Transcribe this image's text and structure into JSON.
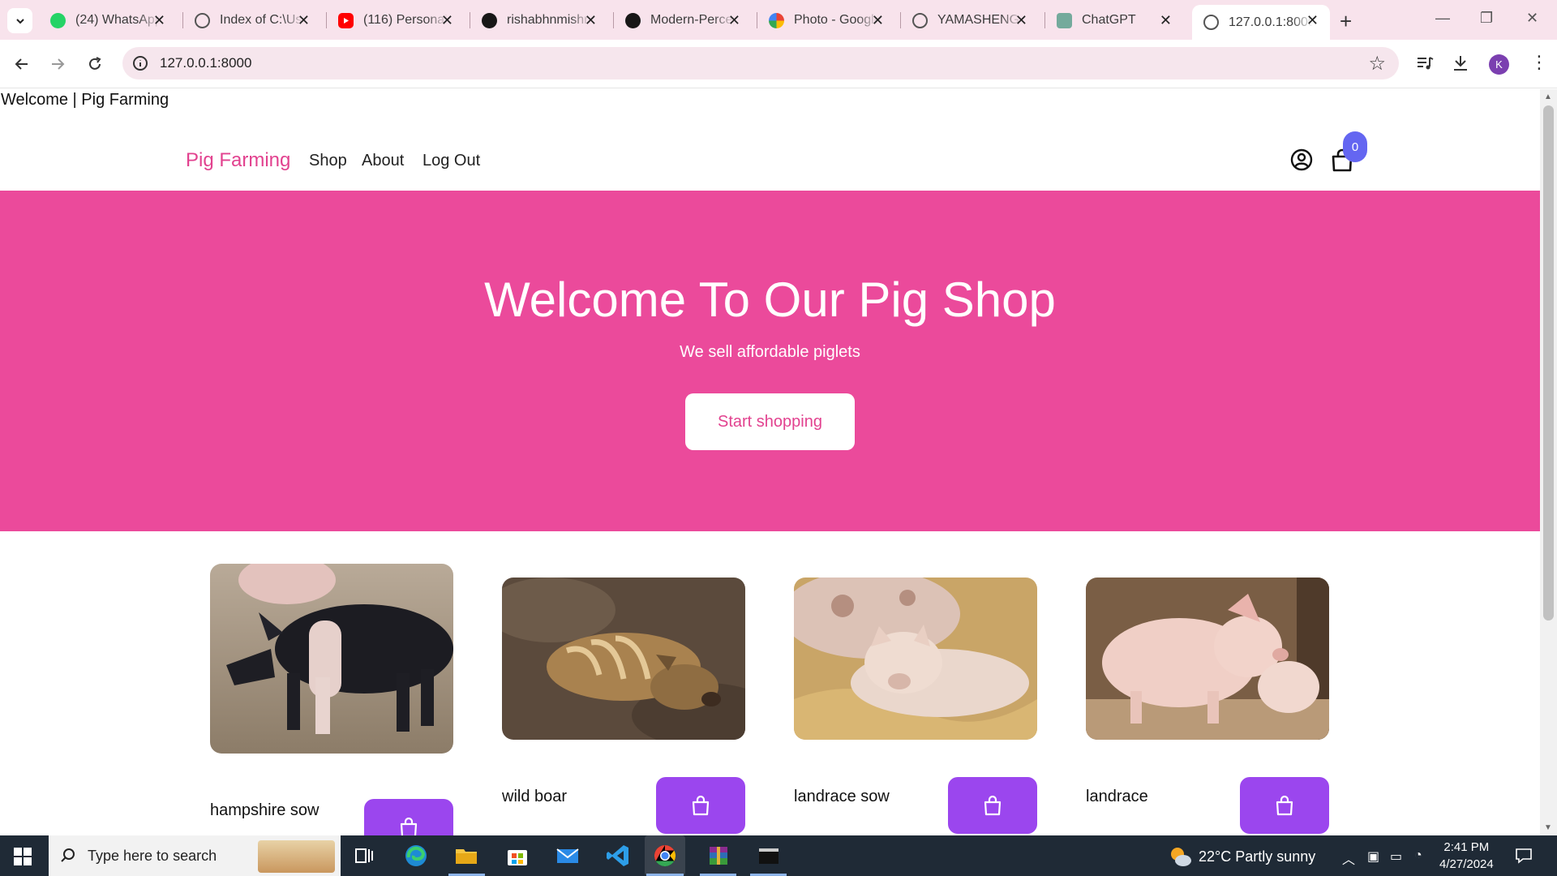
{
  "browser": {
    "tabs": [
      {
        "title": "(24) WhatsApp",
        "icon": "whatsapp-icon"
      },
      {
        "title": "Index of C:\\Users",
        "icon": "globe-icon"
      },
      {
        "title": "(116) Personal",
        "icon": "youtube-icon"
      },
      {
        "title": "rishabhnmishra",
        "icon": "github-icon"
      },
      {
        "title": "Modern-Perceptron",
        "icon": "github-icon"
      },
      {
        "title": "Photo - Google",
        "icon": "google-photos-icon"
      },
      {
        "title": "YAMASHENG",
        "icon": "globe-icon"
      },
      {
        "title": "ChatGPT",
        "icon": "chatgpt-icon"
      },
      {
        "title": "127.0.0.1:8000",
        "icon": "globe-icon",
        "active": true
      }
    ],
    "url": "127.0.0.1:8000",
    "profile_initial": "K"
  },
  "page": {
    "document_title": "Welcome | Pig Farming",
    "nav": {
      "brand": "Pig Farming",
      "links": [
        "Shop",
        "About",
        "Log Out"
      ],
      "cart_count": "0"
    },
    "hero": {
      "title": "Welcome To Our Pig Shop",
      "subtitle": "We sell affordable piglets",
      "button": "Start shopping"
    },
    "products": [
      {
        "name": "hampshire sow",
        "image": "black pig with white belt band"
      },
      {
        "name": "wild boar",
        "image": "striped wild boar piglet lying in dirt"
      },
      {
        "name": "landrace sow",
        "image": "pink pigs lying in straw"
      },
      {
        "name": "landrace",
        "image": "pink piglets standing in pen"
      }
    ]
  },
  "taskbar": {
    "search_placeholder": "Type here to search",
    "weather": "22°C  Partly sunny",
    "time": "2:41 PM",
    "date": "4/27/2024"
  },
  "colors": {
    "hero": "#eb4a9b",
    "brand": "#e2428f",
    "buy_button": "#9b46ee",
    "badge": "#6466f1"
  }
}
